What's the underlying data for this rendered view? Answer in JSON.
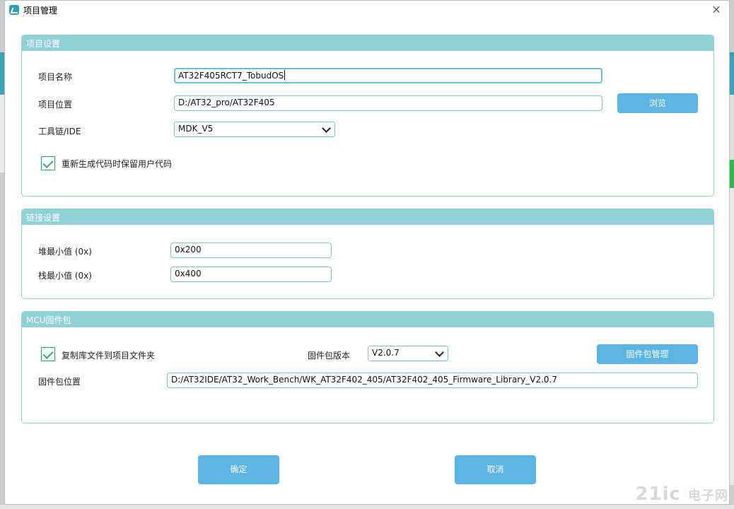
{
  "window": {
    "title": "项目管理"
  },
  "project_settings": {
    "header": "项目设置",
    "name_label": "项目名称",
    "name_value": "AT32F405RCT7_TobudOS",
    "location_label": "项目位置",
    "location_value": "D:/AT32_pro/AT32F405",
    "browse_label": "浏览",
    "toolchain_label": "工具链/IDE",
    "toolchain_value": "MDK_V5",
    "keep_code_label": "重新生成代码时保留用户代码",
    "keep_code_checked": true
  },
  "link_settings": {
    "header": "链接设置",
    "heap_label": "堆最小值 (0x)",
    "heap_value": "0x200",
    "stack_label": "栈最小值 (0x)",
    "stack_value": "0x400"
  },
  "firmware": {
    "header": "MCU固件包",
    "copy_label": "复制库文件到项目文件夹",
    "copy_checked": true,
    "version_label": "固件包版本",
    "version_value": "V2.0.7",
    "manage_label": "固件包管理",
    "location_label": "固件包位置",
    "location_value": "D:/AT32IDE/AT32_Work_Bench/WK_AT32F402_405/AT32F402_405_Firmware_Library_V2.0.7"
  },
  "buttons": {
    "ok": "确定",
    "cancel": "取消"
  },
  "watermark": {
    "main": "21ic",
    "sub": "电子网"
  },
  "colors": {
    "group_header": "#8fd0d8",
    "button": "#5bb4e3",
    "checkbox": "#2bab6a",
    "field_border": "#7ec3cf"
  },
  "icons": {
    "app": "app-logo-icon",
    "close": "close-icon",
    "dropdown": "chevron-down-icon",
    "check": "checkmark-icon"
  }
}
